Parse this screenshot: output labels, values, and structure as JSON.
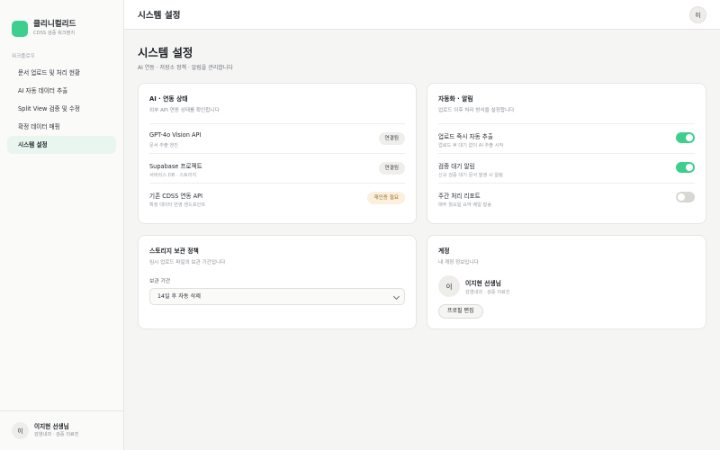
{
  "brand": {
    "name": "클리니컬리드",
    "subtitle": "CDSS 검증 워크벤치"
  },
  "sidebar": {
    "section_label": "워크플로우",
    "items": [
      {
        "label": "문서 업로드 및 처리 현황",
        "active": false
      },
      {
        "label": "AI 자동 데이터 추출",
        "active": false
      },
      {
        "label": "Split View 검증 및 수정",
        "active": false
      },
      {
        "label": "확정 데이터 매핑",
        "active": false
      },
      {
        "label": "시스템 설정",
        "active": true
      }
    ],
    "user": {
      "initial": "이",
      "name": "이지현 선생님",
      "role": "감염내과 · 검증 의료진"
    }
  },
  "header": {
    "title": "시스템 설정",
    "avatar_initial": "이"
  },
  "page": {
    "title": "시스템 설정",
    "subtitle": "AI 연동 · 저장소 정책 · 알림을 관리합니다"
  },
  "ai_card": {
    "title": "AI · 연동 상태",
    "subtitle": "외부 API 연동 상태를 확인합니다",
    "rows": [
      {
        "title": "GPT-4o Vision API",
        "sub": "문서 추출 엔진",
        "badge": "연결됨",
        "status": "ok"
      },
      {
        "title": "Supabase 프로젝트",
        "sub": "서버리스 DB · 스토리지",
        "badge": "연결됨",
        "status": "ok"
      },
      {
        "title": "기존 CDSS 연동 API",
        "sub": "확정 데이터 반영 엔드포인트",
        "badge": "재인증 필요",
        "status": "warn"
      }
    ]
  },
  "automation_card": {
    "title": "자동화 · 알림",
    "subtitle": "업로드 이후 처리 방식을 설정합니다",
    "rows": [
      {
        "title": "업로드 즉시 자동 추출",
        "sub": "업로드 후 대기 없이 AI 추출 시작",
        "enabled": true
      },
      {
        "title": "검증 대기 알림",
        "sub": "신규 검증 대기 문서 발생 시 알림",
        "enabled": true
      },
      {
        "title": "주간 처리 리포트",
        "sub": "매주 월요일 요약 메일 발송",
        "enabled": false
      }
    ]
  },
  "storage_card": {
    "title": "스토리지 보관 정책",
    "subtitle": "임시 업로드 파일의 보관 기간입니다",
    "field_label": "보관 기간",
    "selected": "14일 후 자동 삭제"
  },
  "account_card": {
    "title": "계정",
    "subtitle": "내 계정 정보입니다",
    "initial": "이",
    "name": "이지현 선생님",
    "role": "감염내과 · 검증 의료진",
    "edit_label": "프로필 편집"
  },
  "colors": {
    "accent": "#3ecf8e",
    "active_bg": "#e9f6ef",
    "warn_bg": "#fbf0de",
    "warn_text": "#9a6a16"
  }
}
